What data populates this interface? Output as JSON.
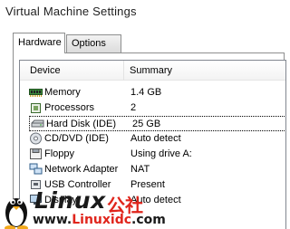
{
  "window": {
    "title": "Virtual Machine Settings"
  },
  "tabs": [
    {
      "label": "Hardware",
      "active": true
    },
    {
      "label": "Options",
      "active": false
    }
  ],
  "device_list": {
    "columns": [
      "Device",
      "Summary"
    ],
    "rows": [
      {
        "device": "Memory",
        "summary": "1.4 GB",
        "icon": "memory-icon"
      },
      {
        "device": "Processors",
        "summary": "2",
        "icon": "processor-icon"
      },
      {
        "device": "Hard Disk (IDE)",
        "summary": "25 GB",
        "icon": "hard-disk-icon",
        "selected": true
      },
      {
        "device": "CD/DVD (IDE)",
        "summary": "Auto detect",
        "icon": "cd-dvd-icon"
      },
      {
        "device": "Floppy",
        "summary": "Using drive A:",
        "icon": "floppy-icon"
      },
      {
        "device": "Network Adapter",
        "summary": "NAT",
        "icon": "network-adapter-icon"
      },
      {
        "device": "USB Controller",
        "summary": "Present",
        "icon": "usb-controller-icon"
      },
      {
        "device": "Display",
        "summary": "Auto detect",
        "icon": "display-icon"
      }
    ]
  },
  "watermark": {
    "logo_text": "Linux",
    "cn_text": "公社",
    "url_prefix": "www.",
    "url_main": "Linuxidc",
    "url_suffix": ".com"
  },
  "colors": {
    "selection_border": "#000000",
    "watermark_red": "#e0251c"
  }
}
